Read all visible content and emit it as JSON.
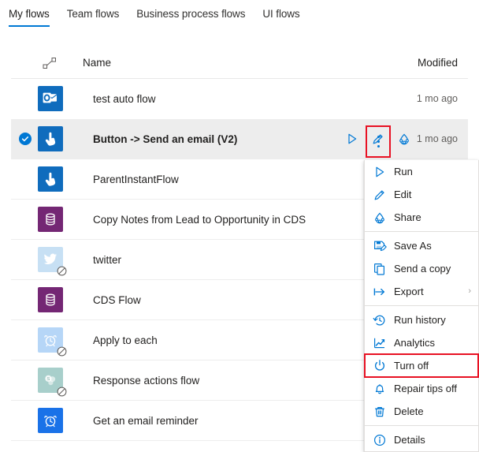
{
  "tabs": [
    {
      "label": "My flows",
      "active": true
    },
    {
      "label": "Team flows",
      "active": false
    },
    {
      "label": "Business process flows",
      "active": false
    },
    {
      "label": "UI flows",
      "active": false
    }
  ],
  "columns": {
    "flow_icon": "flow-connector-icon",
    "name": "Name",
    "modified": "Modified"
  },
  "rows": [
    {
      "name": "test auto flow",
      "modified": "1 mo ago",
      "icon": "outlook-icon",
      "icon_bg": "#0f6cbd",
      "selected": false,
      "disabled": false
    },
    {
      "name": "Button -> Send an email (V2)",
      "modified": "1 mo ago",
      "icon": "button-tap-icon",
      "icon_bg": "#0f6cbd",
      "selected": true,
      "disabled": false
    },
    {
      "name": "ParentInstantFlow",
      "modified": "",
      "icon": "button-tap-icon",
      "icon_bg": "#0f6cbd",
      "selected": false,
      "disabled": false
    },
    {
      "name": "Copy Notes from Lead to Opportunity in CDS",
      "modified": "",
      "icon": "database-icon",
      "icon_bg": "#742774",
      "selected": false,
      "disabled": false
    },
    {
      "name": "twitter",
      "modified": "",
      "icon": "twitter-icon",
      "icon_bg": "#c7e0f4",
      "selected": false,
      "disabled": true
    },
    {
      "name": "CDS Flow",
      "modified": "",
      "icon": "database-icon",
      "icon_bg": "#742774",
      "selected": false,
      "disabled": false
    },
    {
      "name": "Apply to each",
      "modified": "",
      "icon": "alarm-clock-icon",
      "icon_bg": "#b6d6f7",
      "selected": false,
      "disabled": true
    },
    {
      "name": "Response actions flow",
      "modified": "",
      "icon": "sharepoint-icon",
      "icon_bg": "#a8cfcb",
      "selected": false,
      "disabled": true
    },
    {
      "name": "Get an email reminder",
      "modified": "",
      "icon": "alarm-clock-icon",
      "icon_bg": "#1a72e8",
      "selected": false,
      "disabled": false
    }
  ],
  "row_actions": [
    {
      "name": "run-icon",
      "title": "Run"
    },
    {
      "name": "edit-icon",
      "title": "Edit"
    },
    {
      "name": "share-icon",
      "title": "Share"
    }
  ],
  "overflow_button": {
    "name": "more-options-ellipsis",
    "highlighted": true,
    "highlight_color": "#e81123"
  },
  "menu": {
    "items": [
      {
        "label": "Run",
        "icon": "run-triangle-icon",
        "sep_after": false,
        "submenu": false,
        "highlight": false
      },
      {
        "label": "Edit",
        "icon": "pencil-icon",
        "sep_after": false,
        "submenu": false,
        "highlight": false
      },
      {
        "label": "Share",
        "icon": "share-icon",
        "sep_after": true,
        "submenu": false,
        "highlight": false
      },
      {
        "label": "Save As",
        "icon": "save-as-icon",
        "sep_after": false,
        "submenu": false,
        "highlight": false
      },
      {
        "label": "Send a copy",
        "icon": "copy-icon",
        "sep_after": false,
        "submenu": false,
        "highlight": false
      },
      {
        "label": "Export",
        "icon": "export-arrow-icon",
        "sep_after": true,
        "submenu": true,
        "highlight": false
      },
      {
        "label": "Run history",
        "icon": "history-clock-icon",
        "sep_after": false,
        "submenu": false,
        "highlight": false
      },
      {
        "label": "Analytics",
        "icon": "analytics-chart-icon",
        "sep_after": false,
        "submenu": false,
        "highlight": false
      },
      {
        "label": "Turn off",
        "icon": "power-icon",
        "sep_after": false,
        "submenu": false,
        "highlight": true
      },
      {
        "label": "Repair tips off",
        "icon": "bell-icon",
        "sep_after": false,
        "submenu": false,
        "highlight": false
      },
      {
        "label": "Delete",
        "icon": "trash-icon",
        "sep_after": true,
        "submenu": false,
        "highlight": false
      },
      {
        "label": "Details",
        "icon": "info-icon",
        "sep_after": false,
        "submenu": false,
        "highlight": false
      }
    ],
    "submenu_chevron": "›",
    "highlight_color": "#e81123"
  },
  "colors": {
    "accent": "#0078d4",
    "selected_row_bg": "#ededed",
    "divider": "#ededed",
    "highlight_red": "#e81123"
  }
}
